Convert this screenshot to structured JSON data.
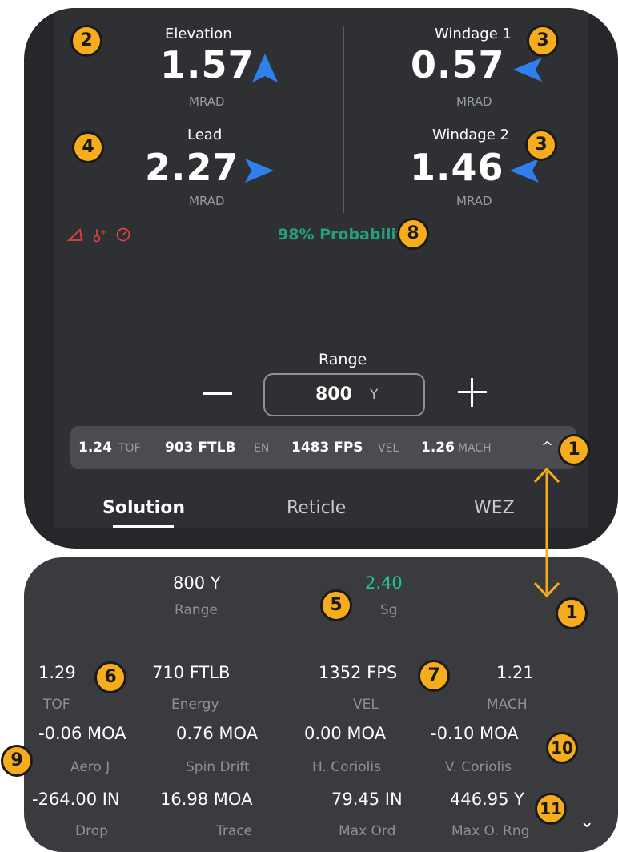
{
  "elevation": {
    "label": "Elevation",
    "value": "1.57",
    "unit": "MRAD"
  },
  "windage1": {
    "label": "Windage 1",
    "value": "0.57",
    "unit": "MRAD"
  },
  "lead": {
    "label": "Lead",
    "value": "2.27",
    "unit": "MRAD"
  },
  "windage2": {
    "label": "Windage 2",
    "value": "1.46",
    "unit": "MRAD"
  },
  "probability": "98% Probability",
  "range": {
    "label": "Range",
    "value": "800",
    "unit": "Y",
    "minus": "—",
    "plus": "+"
  },
  "bar": {
    "tof_v": "1.24",
    "tof_u": "TOF",
    "en_v": "903 FTLB",
    "en_u": "EN",
    "vel_v": "1483 FPS",
    "vel_u": "VEL",
    "mach_v": "1.26",
    "mach_u": "MACH",
    "chevron": "^"
  },
  "tabs": [
    {
      "label": "Solution"
    },
    {
      "label": "Reticle"
    },
    {
      "label": "WEZ"
    }
  ],
  "badges": {
    "b1": "1",
    "b2": "2",
    "b3": "3",
    "b4": "4",
    "b5": "5",
    "b6": "6",
    "b7": "7",
    "b8": "8",
    "b9": "9",
    "b10": "10",
    "b11": "11"
  },
  "detail": {
    "range_v": "800 Y",
    "range_l": "Range",
    "sg_v": "2.40",
    "sg_l": "Sg",
    "row1": [
      {
        "v": "1.29",
        "l": "TOF"
      },
      {
        "v": "710 FTLB",
        "l": "Energy"
      },
      {
        "v": "1352 FPS",
        "l": "VEL"
      },
      {
        "v": "1.21",
        "l": "MACH"
      }
    ],
    "row2": [
      {
        "v": "-0.06 MOA",
        "l": "Aero J"
      },
      {
        "v": "0.76 MOA",
        "l": "Spin Drift"
      },
      {
        "v": "0.00 MOA",
        "l": "H. Coriolis"
      },
      {
        "v": "-0.10 MOA",
        "l": "V. Coriolis"
      }
    ],
    "row3": [
      {
        "v": "-264.00 IN",
        "l": "Drop"
      },
      {
        "v": "16.98 MOA",
        "l": "Trace"
      },
      {
        "v": "79.45 IN",
        "l": "Max Ord"
      },
      {
        "v": "446.95 Y",
        "l": "Max O. Rng"
      }
    ],
    "chevron": "⌄"
  },
  "colors": {
    "arrow": "#2f80ed",
    "accent": "#f7ad1b",
    "green": "#22a17a",
    "warn": "#e0443e"
  },
  "icons": [
    "angle-warning-icon",
    "temperature-warning-icon",
    "speed-warning-icon"
  ]
}
